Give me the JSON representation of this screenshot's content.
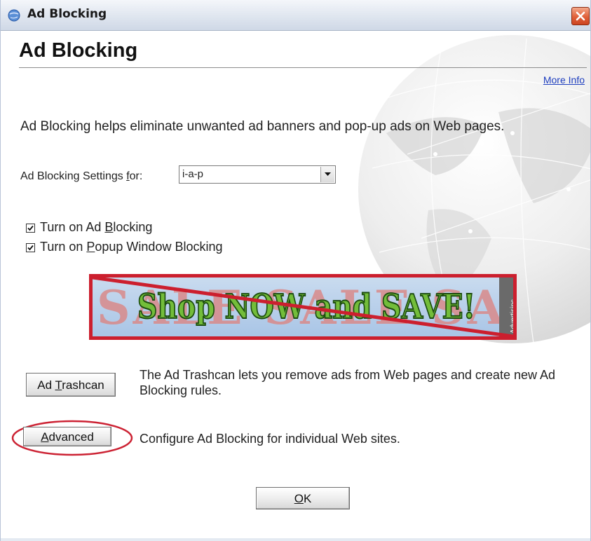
{
  "window": {
    "title": "Ad Blocking"
  },
  "header": {
    "heading": "Ad Blocking",
    "more_info": "More Info"
  },
  "description": "Ad Blocking helps eliminate unwanted ad banners and pop-up ads on Web pages.",
  "settings": {
    "label_before": "Ad Blocking Settings ",
    "label_underlined": "f",
    "label_after": "or:",
    "selected_value": "i-a-p"
  },
  "checkboxes": [
    {
      "before": "Turn on Ad ",
      "underlined": "B",
      "after": "locking",
      "checked": true
    },
    {
      "before": "Turn on ",
      "underlined": "P",
      "after": "opup Window Blocking",
      "checked": true
    }
  ],
  "banner": {
    "background_text": "SALE SALE SALE",
    "main_text": "Shop NOW and SAVE!",
    "side_text": "Advertisinc"
  },
  "trashcan": {
    "button_before": "Ad ",
    "button_underlined": "T",
    "button_after": "rashcan",
    "description": "The Ad Trashcan lets you remove ads from Web pages and create new Ad Blocking rules."
  },
  "advanced": {
    "button_before": "",
    "button_underlined": "A",
    "button_after": "dvanced",
    "description": "Configure Ad Blocking for individual Web sites."
  },
  "ok": {
    "button_underlined": "O",
    "button_after": "K"
  },
  "colors": {
    "highlight_ellipse": "#cc2233",
    "banner_border": "#cc1f2e",
    "link": "#1f3fbf"
  }
}
